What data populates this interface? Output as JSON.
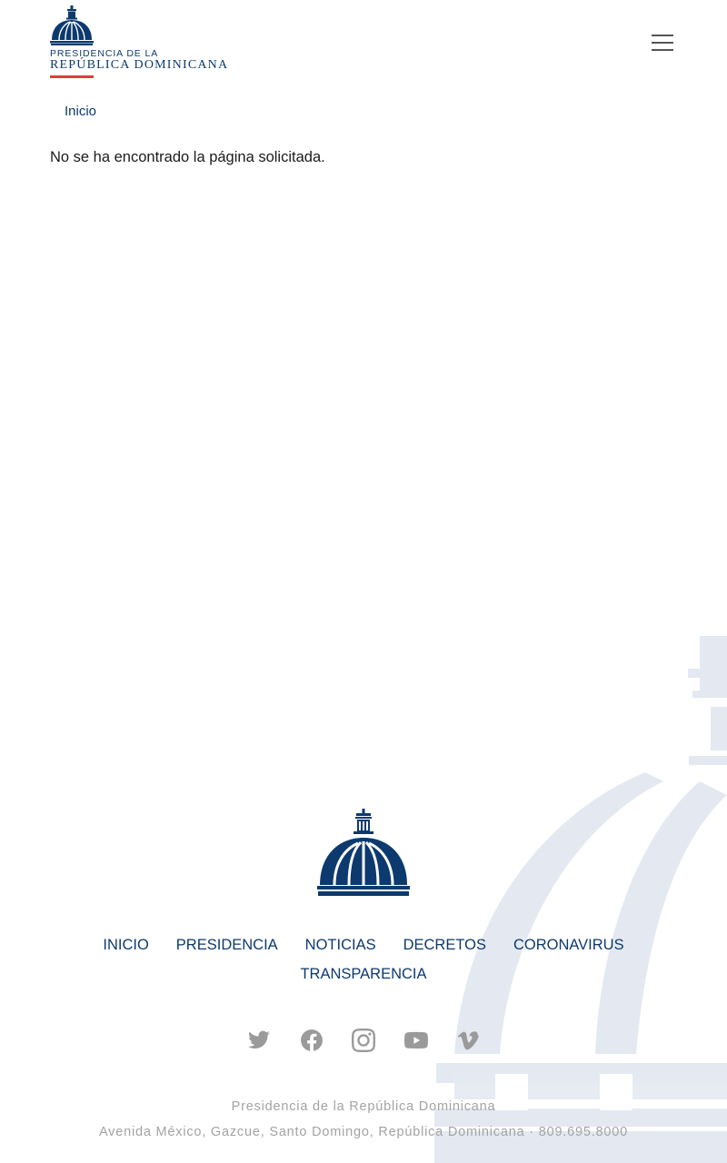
{
  "header": {
    "logo": {
      "line1": "PRESIDENCIA DE LA",
      "line2": "REPÚBLICA DOMINICANA",
      "icon": "capitol-dome-icon"
    },
    "menu_icon": "hamburger-menu-icon"
  },
  "breadcrumb": {
    "home_label": "Inicio"
  },
  "main": {
    "message": "No se ha encontrado la página solicitada."
  },
  "footer": {
    "logo_icon": "capitol-dome-icon",
    "nav": [
      "INICIO",
      "PRESIDENCIA",
      "NOTICIAS",
      "DECRETOS",
      "CORONAVIRUS",
      "TRANSPARENCIA"
    ],
    "social": [
      "twitter-icon",
      "facebook-icon",
      "instagram-icon",
      "youtube-icon",
      "vimeo-icon"
    ],
    "org_name": "Presidencia de la República Dominicana",
    "address": "Avenida México, Gazcue, Santo Domingo, República Dominicana · 809.695.8000"
  },
  "colors": {
    "brand_blue": "#0d3a6e",
    "accent_red": "#e23b3b",
    "watermark": "#e3e8f0",
    "muted_text": "#a3a3a3"
  }
}
